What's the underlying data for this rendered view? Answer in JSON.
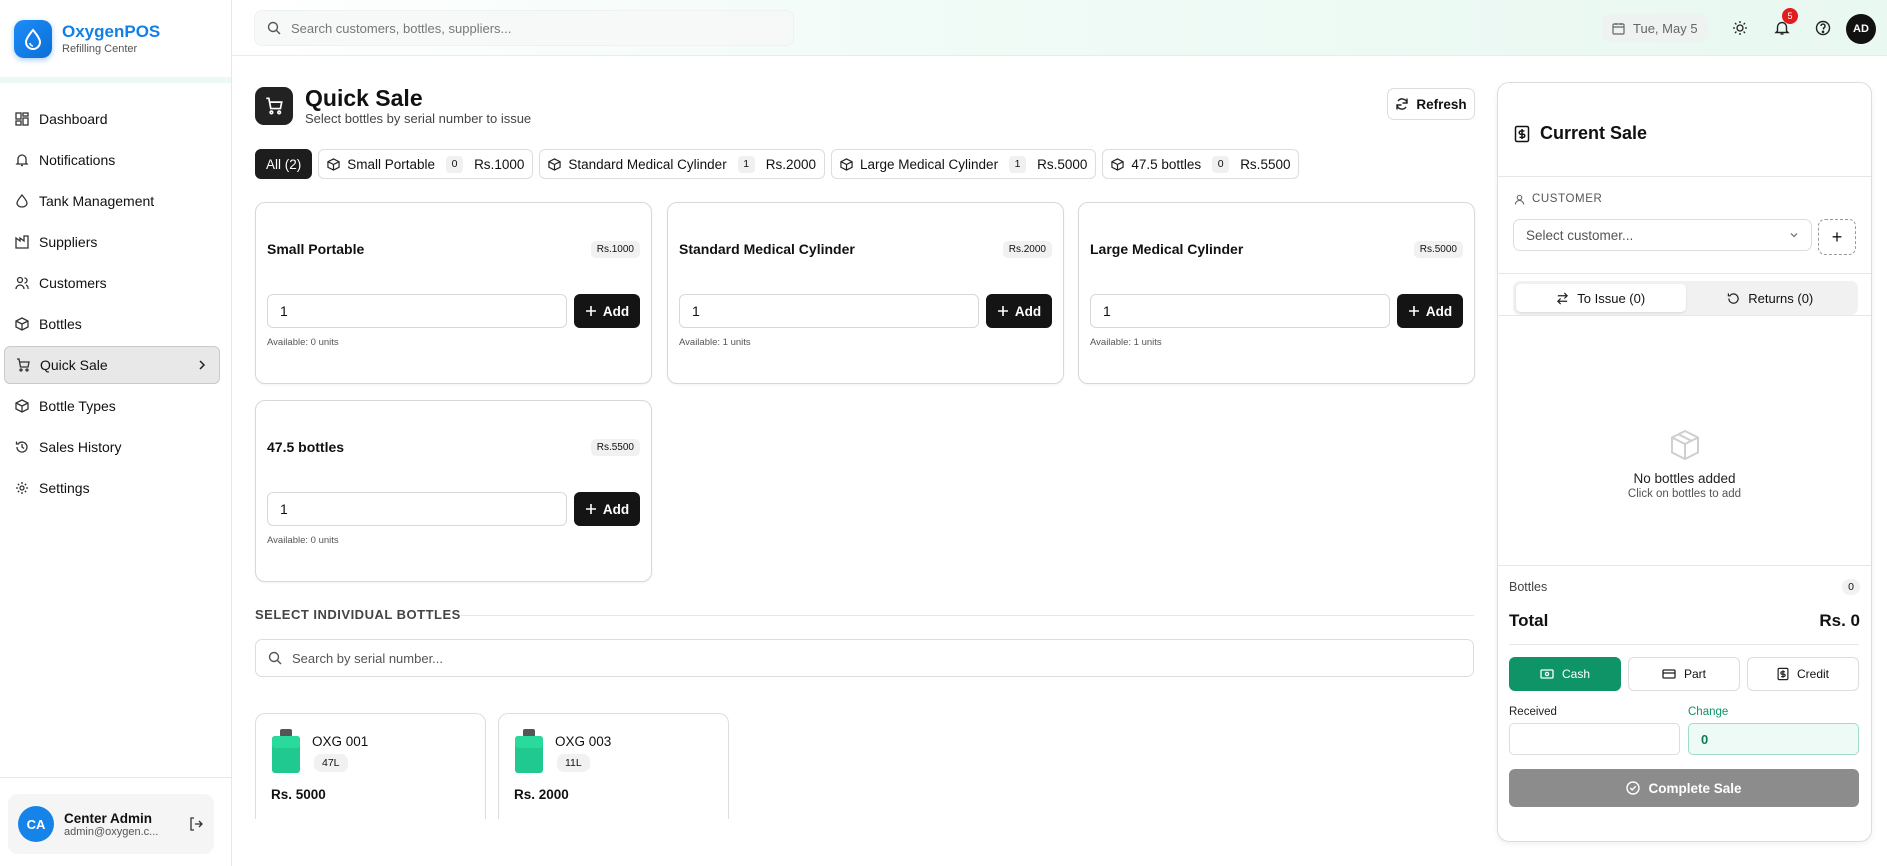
{
  "brand": {
    "title": "OxygenPOS",
    "subtitle": "Refilling Center"
  },
  "sidebar": {
    "items": [
      {
        "label": "Dashboard",
        "icon": "dashboard-icon"
      },
      {
        "label": "Notifications",
        "icon": "bell-icon"
      },
      {
        "label": "Tank Management",
        "icon": "tank-icon"
      },
      {
        "label": "Suppliers",
        "icon": "factory-icon"
      },
      {
        "label": "Customers",
        "icon": "users-icon"
      },
      {
        "label": "Bottles",
        "icon": "box-icon"
      },
      {
        "label": "Quick Sale",
        "icon": "cart-icon",
        "active": true
      },
      {
        "label": "Bottle Types",
        "icon": "box-icon"
      },
      {
        "label": "Sales History",
        "icon": "history-icon"
      },
      {
        "label": "Settings",
        "icon": "gear-icon"
      }
    ],
    "user": {
      "initials": "CA",
      "name": "Center Admin",
      "email": "admin@oxygen.c..."
    }
  },
  "topbar": {
    "search_placeholder": "Search customers, bottles, suppliers...",
    "date": "Tue, May 5",
    "notification_count": "5",
    "avatar_initials": "AD"
  },
  "main": {
    "title": "Quick Sale",
    "subtitle": "Select bottles by serial number to issue",
    "refresh_label": "Refresh",
    "filters": [
      {
        "label": "All (2)",
        "active": true
      },
      {
        "label": "Small Portable",
        "count": "0",
        "price": "Rs.1000"
      },
      {
        "label": "Standard Medical Cylinder",
        "count": "1",
        "price": "Rs.2000"
      },
      {
        "label": "Large Medical Cylinder",
        "count": "1",
        "price": "Rs.5000"
      },
      {
        "label": "47.5 bottles",
        "count": "0",
        "price": "Rs.5500"
      }
    ],
    "types": [
      {
        "name": "Small Portable",
        "price": "Rs.1000",
        "qty": "1",
        "add_label": "Add",
        "available": "Available: 0 units"
      },
      {
        "name": "Standard Medical Cylinder",
        "price": "Rs.2000",
        "qty": "1",
        "add_label": "Add",
        "available": "Available: 1 units"
      },
      {
        "name": "Large Medical Cylinder",
        "price": "Rs.5000",
        "qty": "1",
        "add_label": "Add",
        "available": "Available: 1 units"
      },
      {
        "name": "47.5 bottles",
        "price": "Rs.5500",
        "qty": "1",
        "add_label": "Add",
        "available": "Available: 0 units"
      }
    ],
    "section_label": "SELECT INDIVIDUAL BOTTLES",
    "serial_search_placeholder": "Search by serial number...",
    "bottles": [
      {
        "serial": "OXG 001",
        "size": "47L",
        "price": "Rs. 5000"
      },
      {
        "serial": "OXG 003",
        "size": "11L",
        "price": "Rs. 2000"
      }
    ]
  },
  "sale": {
    "title": "Current Sale",
    "customer_label": "CUSTOMER",
    "customer_placeholder": "Select customer...",
    "add_customer": "+",
    "tab_issue": "To Issue (0)",
    "tab_returns": "Returns (0)",
    "empty_title": "No bottles added",
    "empty_sub": "Click on bottles to add",
    "bottles_label": "Bottles",
    "bottles_count": "0",
    "total_label": "Total",
    "total_value": "Rs. 0",
    "pay_cash": "Cash",
    "pay_part": "Part",
    "pay_credit": "Credit",
    "received_label": "Received",
    "change_label": "Change",
    "change_value": "0",
    "complete_label": "Complete Sale"
  },
  "colors": {
    "accent": "#0e9467",
    "brand": "#1280e6",
    "badge": "#e11d1d"
  }
}
